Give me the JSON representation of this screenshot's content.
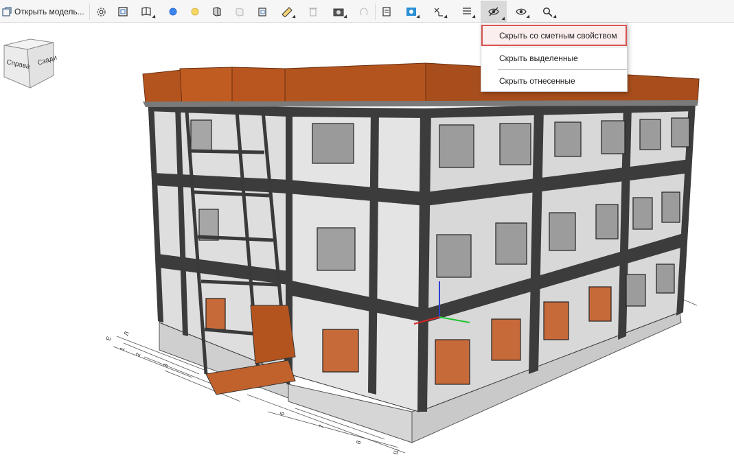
{
  "toolbar": {
    "open_model_label": "Открыть модель...",
    "buttons": [
      {
        "icon": "gear-icon"
      },
      {
        "icon": "fit-view-icon"
      },
      {
        "icon": "section-box-icon"
      },
      {
        "icon": "blue-circle-icon",
        "color": "#3d86ee"
      },
      {
        "icon": "yellow-circle-icon",
        "color": "#f7d766"
      },
      {
        "icon": "copy-model-icon"
      },
      {
        "icon": "link-model-icon",
        "state": "disabled"
      },
      {
        "icon": "clipboard-icon"
      },
      {
        "icon": "ruler-icon"
      },
      {
        "icon": "trash-icon",
        "state": "disabled"
      },
      {
        "icon": "camera-icon"
      },
      {
        "icon": "fingerprint-icon",
        "state": "disabled"
      },
      {
        "icon": "document-icon"
      },
      {
        "icon": "settings-panel-icon"
      },
      {
        "icon": "xyz-axis-icon"
      },
      {
        "icon": "list-icon"
      },
      {
        "icon": "hide-eye-icon",
        "state": "active"
      },
      {
        "icon": "eye-icon"
      },
      {
        "icon": "search-icon"
      }
    ]
  },
  "view_cube": {
    "left_face": "Справа",
    "right_face": "Сзади"
  },
  "hide_menu": {
    "items": [
      {
        "label": "Скрыть со сметным свойством",
        "highlighted": true
      },
      {
        "label": "Скрыть выделенные"
      },
      {
        "label": "Скрыть отнесенные"
      }
    ]
  },
  "grid_labels": {
    "left_axis": [
      "Л",
      "Е",
      "1",
      "2",
      "3"
    ],
    "right_axis": [
      "6",
      "7",
      "8",
      "Ш"
    ]
  },
  "colors": {
    "roof": "#b3541f",
    "wall": "#dcdcdc",
    "frame": "#3c3c3c",
    "highlight": "#d9534f"
  }
}
